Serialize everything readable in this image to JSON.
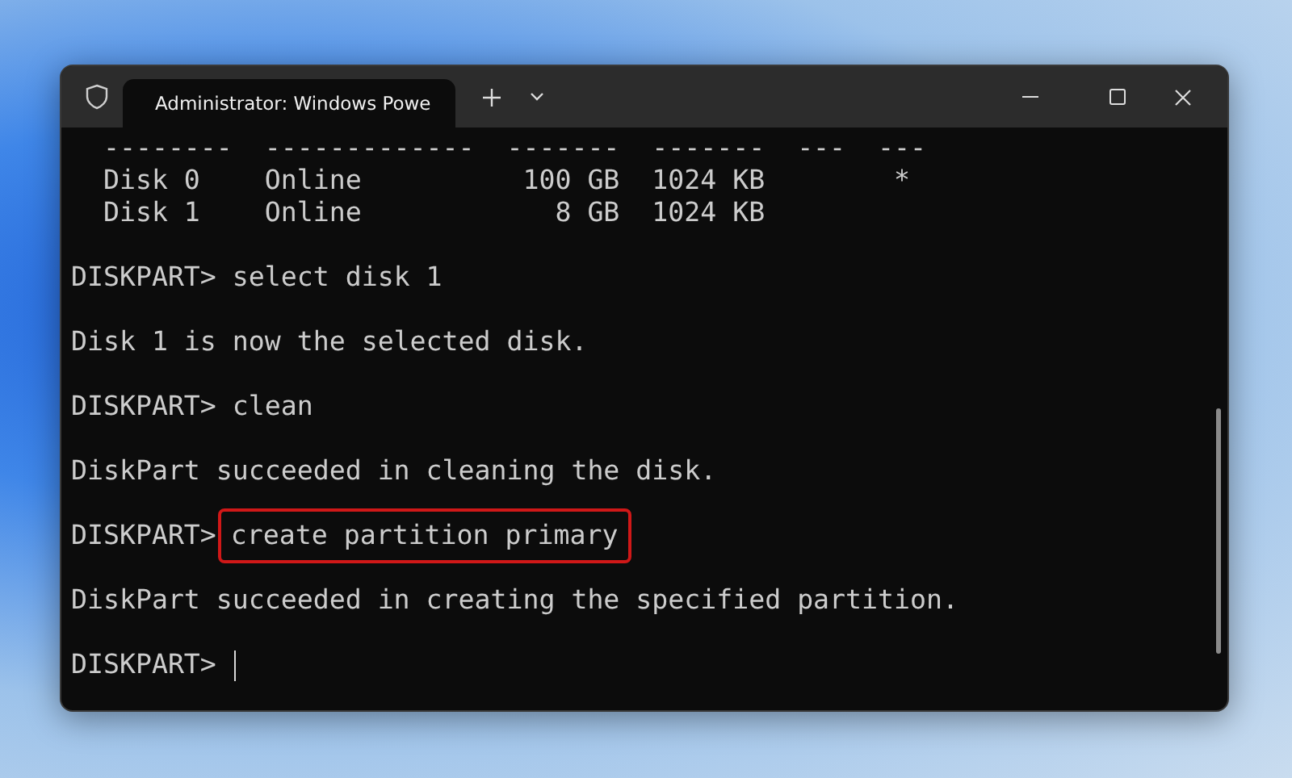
{
  "window": {
    "tab_title": "Administrator: Windows Powe"
  },
  "terminal": {
    "lines": [
      {
        "kind": "output",
        "text": "  --------  -------------  -------  -------  ---  ---"
      },
      {
        "kind": "output",
        "text": "  Disk 0    Online          100 GB  1024 KB        *"
      },
      {
        "kind": "output",
        "text": "  Disk 1    Online            8 GB  1024 KB"
      },
      {
        "kind": "blank"
      },
      {
        "kind": "command",
        "prompt": "DISKPART>",
        "command": "select disk 1",
        "highlighted": false
      },
      {
        "kind": "blank"
      },
      {
        "kind": "output",
        "text": "Disk 1 is now the selected disk."
      },
      {
        "kind": "blank"
      },
      {
        "kind": "command",
        "prompt": "DISKPART>",
        "command": "clean",
        "highlighted": false
      },
      {
        "kind": "blank"
      },
      {
        "kind": "output",
        "text": "DiskPart succeeded in cleaning the disk."
      },
      {
        "kind": "blank"
      },
      {
        "kind": "command",
        "prompt": "DISKPART>",
        "command": "create partition primary",
        "highlighted": true
      },
      {
        "kind": "blank"
      },
      {
        "kind": "output",
        "text": "DiskPart succeeded in creating the specified partition."
      },
      {
        "kind": "blank"
      },
      {
        "kind": "prompt",
        "prompt": "DISKPART>",
        "cursor": true
      }
    ]
  }
}
